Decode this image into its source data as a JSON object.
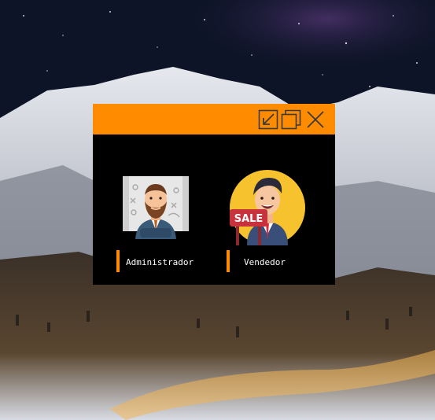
{
  "window": {
    "accent_color": "#ff8c00",
    "background_color": "#000000",
    "controls": [
      {
        "icon": "minimize-arrow-icon"
      },
      {
        "icon": "restore-icon"
      },
      {
        "icon": "close-icon"
      }
    ]
  },
  "roles": [
    {
      "label": "Administrador",
      "icon": "administrator-avatar-icon"
    },
    {
      "label": "Vendedor",
      "icon": "seller-avatar-icon",
      "sign_text": "SALE"
    }
  ]
}
